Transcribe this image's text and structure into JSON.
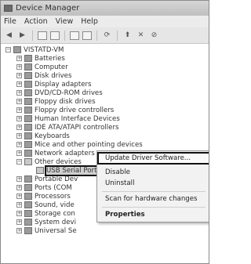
{
  "window": {
    "title": "Device Manager"
  },
  "menu": [
    "File",
    "Action",
    "View",
    "Help"
  ],
  "toolbar": {
    "icons": [
      "back-arrow-icon",
      "forward-arrow-icon",
      "view-icon",
      "view-icon",
      "properties-icon",
      "view-icon",
      "scan-icon",
      "update-driver-icon",
      "uninstall-icon",
      "disable-icon"
    ]
  },
  "tree": {
    "root": "VISTATD-VM",
    "items": [
      "Batteries",
      "Computer",
      "Disk drives",
      "Display adapters",
      "DVD/CD-ROM drives",
      "Floppy disk drives",
      "Floppy drive controllers",
      "Human Interface Devices",
      "IDE ATA/ATAPI controllers",
      "Keyboards",
      "Mice and other pointing devices",
      "Network adapters",
      "Other devices",
      "USB Serial Port",
      "Portable Dev",
      "Ports (COM",
      "Processors",
      "Sound, vide",
      "Storage con",
      "System devi",
      "Universal Se"
    ]
  },
  "context_menu": {
    "items": [
      "Update Driver Software...",
      "Disable",
      "Uninstall",
      "Scan for hardware changes",
      "Properties"
    ]
  }
}
